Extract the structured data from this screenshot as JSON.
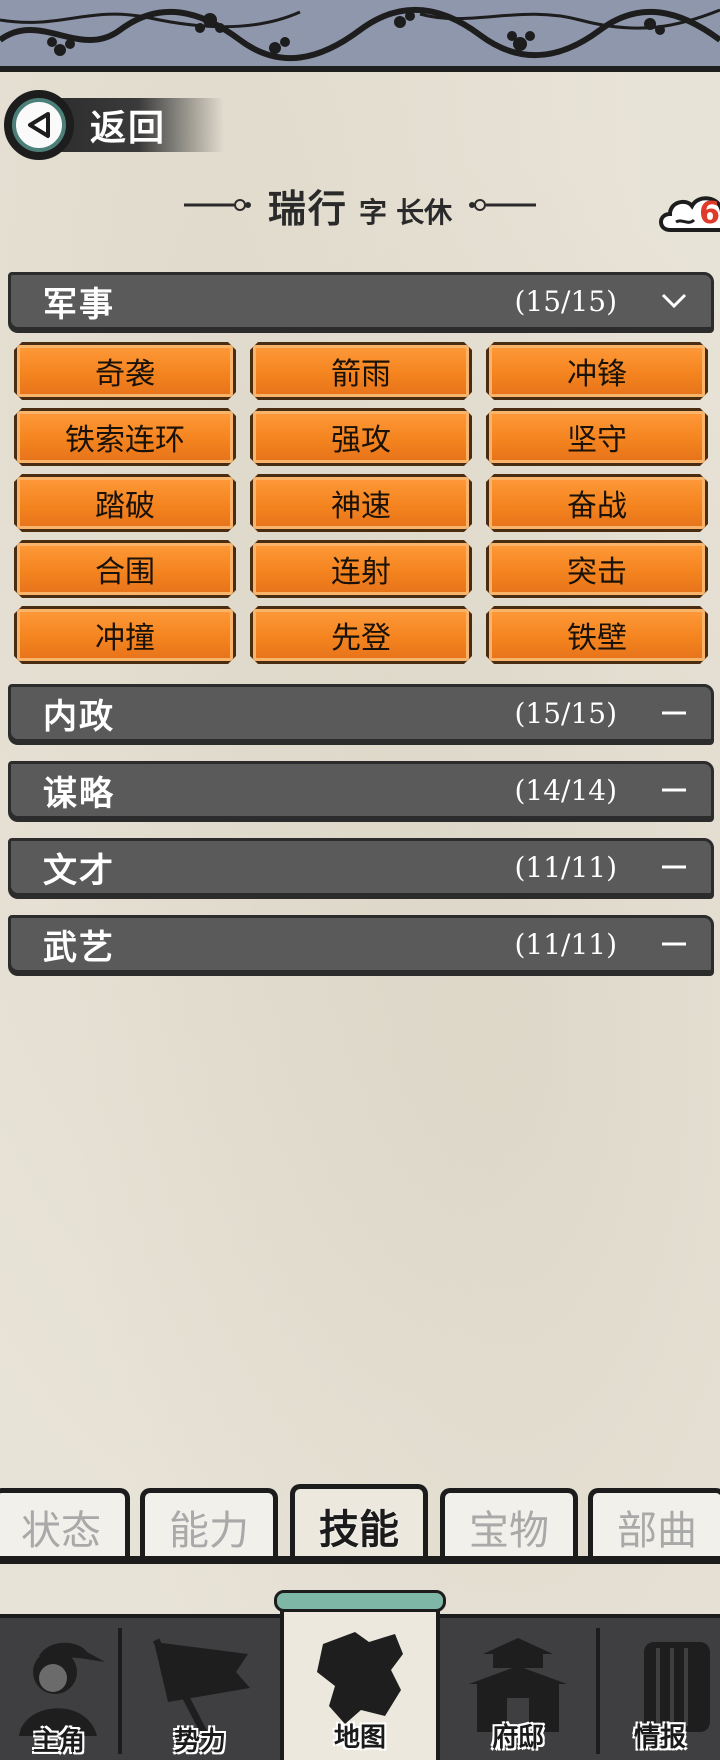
{
  "header": {
    "back_label": "返回",
    "name": "瑞行",
    "zi_label": "字",
    "courtesy_name": "长休",
    "badge_value": "6"
  },
  "categories": [
    {
      "name": "军事",
      "count": "(15/15)",
      "expanded": true,
      "skills": [
        "奇袭",
        "箭雨",
        "冲锋",
        "铁索连环",
        "强攻",
        "坚守",
        "踏破",
        "神速",
        "奋战",
        "合围",
        "连射",
        "突击",
        "冲撞",
        "先登",
        "铁壁"
      ]
    },
    {
      "name": "内政",
      "count": "(15/15)",
      "expanded": false
    },
    {
      "name": "谋略",
      "count": "(14/14)",
      "expanded": false
    },
    {
      "name": "文才",
      "count": "(11/11)",
      "expanded": false
    },
    {
      "name": "武艺",
      "count": "(11/11)",
      "expanded": false
    }
  ],
  "tabs": [
    {
      "label": "状态",
      "active": false
    },
    {
      "label": "能力",
      "active": false
    },
    {
      "label": "技能",
      "active": true
    },
    {
      "label": "宝物",
      "active": false
    },
    {
      "label": "部曲",
      "active": false
    }
  ],
  "bottom_nav": [
    {
      "label": "主角",
      "icon": "warrior-icon"
    },
    {
      "label": "势力",
      "icon": "flag-icon"
    },
    {
      "label": "地图",
      "icon": "map-icon",
      "active": true
    },
    {
      "label": "府邸",
      "icon": "mansion-icon"
    },
    {
      "label": "情报",
      "icon": "scroll-icon"
    }
  ],
  "colors": {
    "skill_button": "#f4841f",
    "category_bar": "#5a5a5a",
    "top_banner": "#8f97ac",
    "badge_number": "#e03a2a"
  }
}
